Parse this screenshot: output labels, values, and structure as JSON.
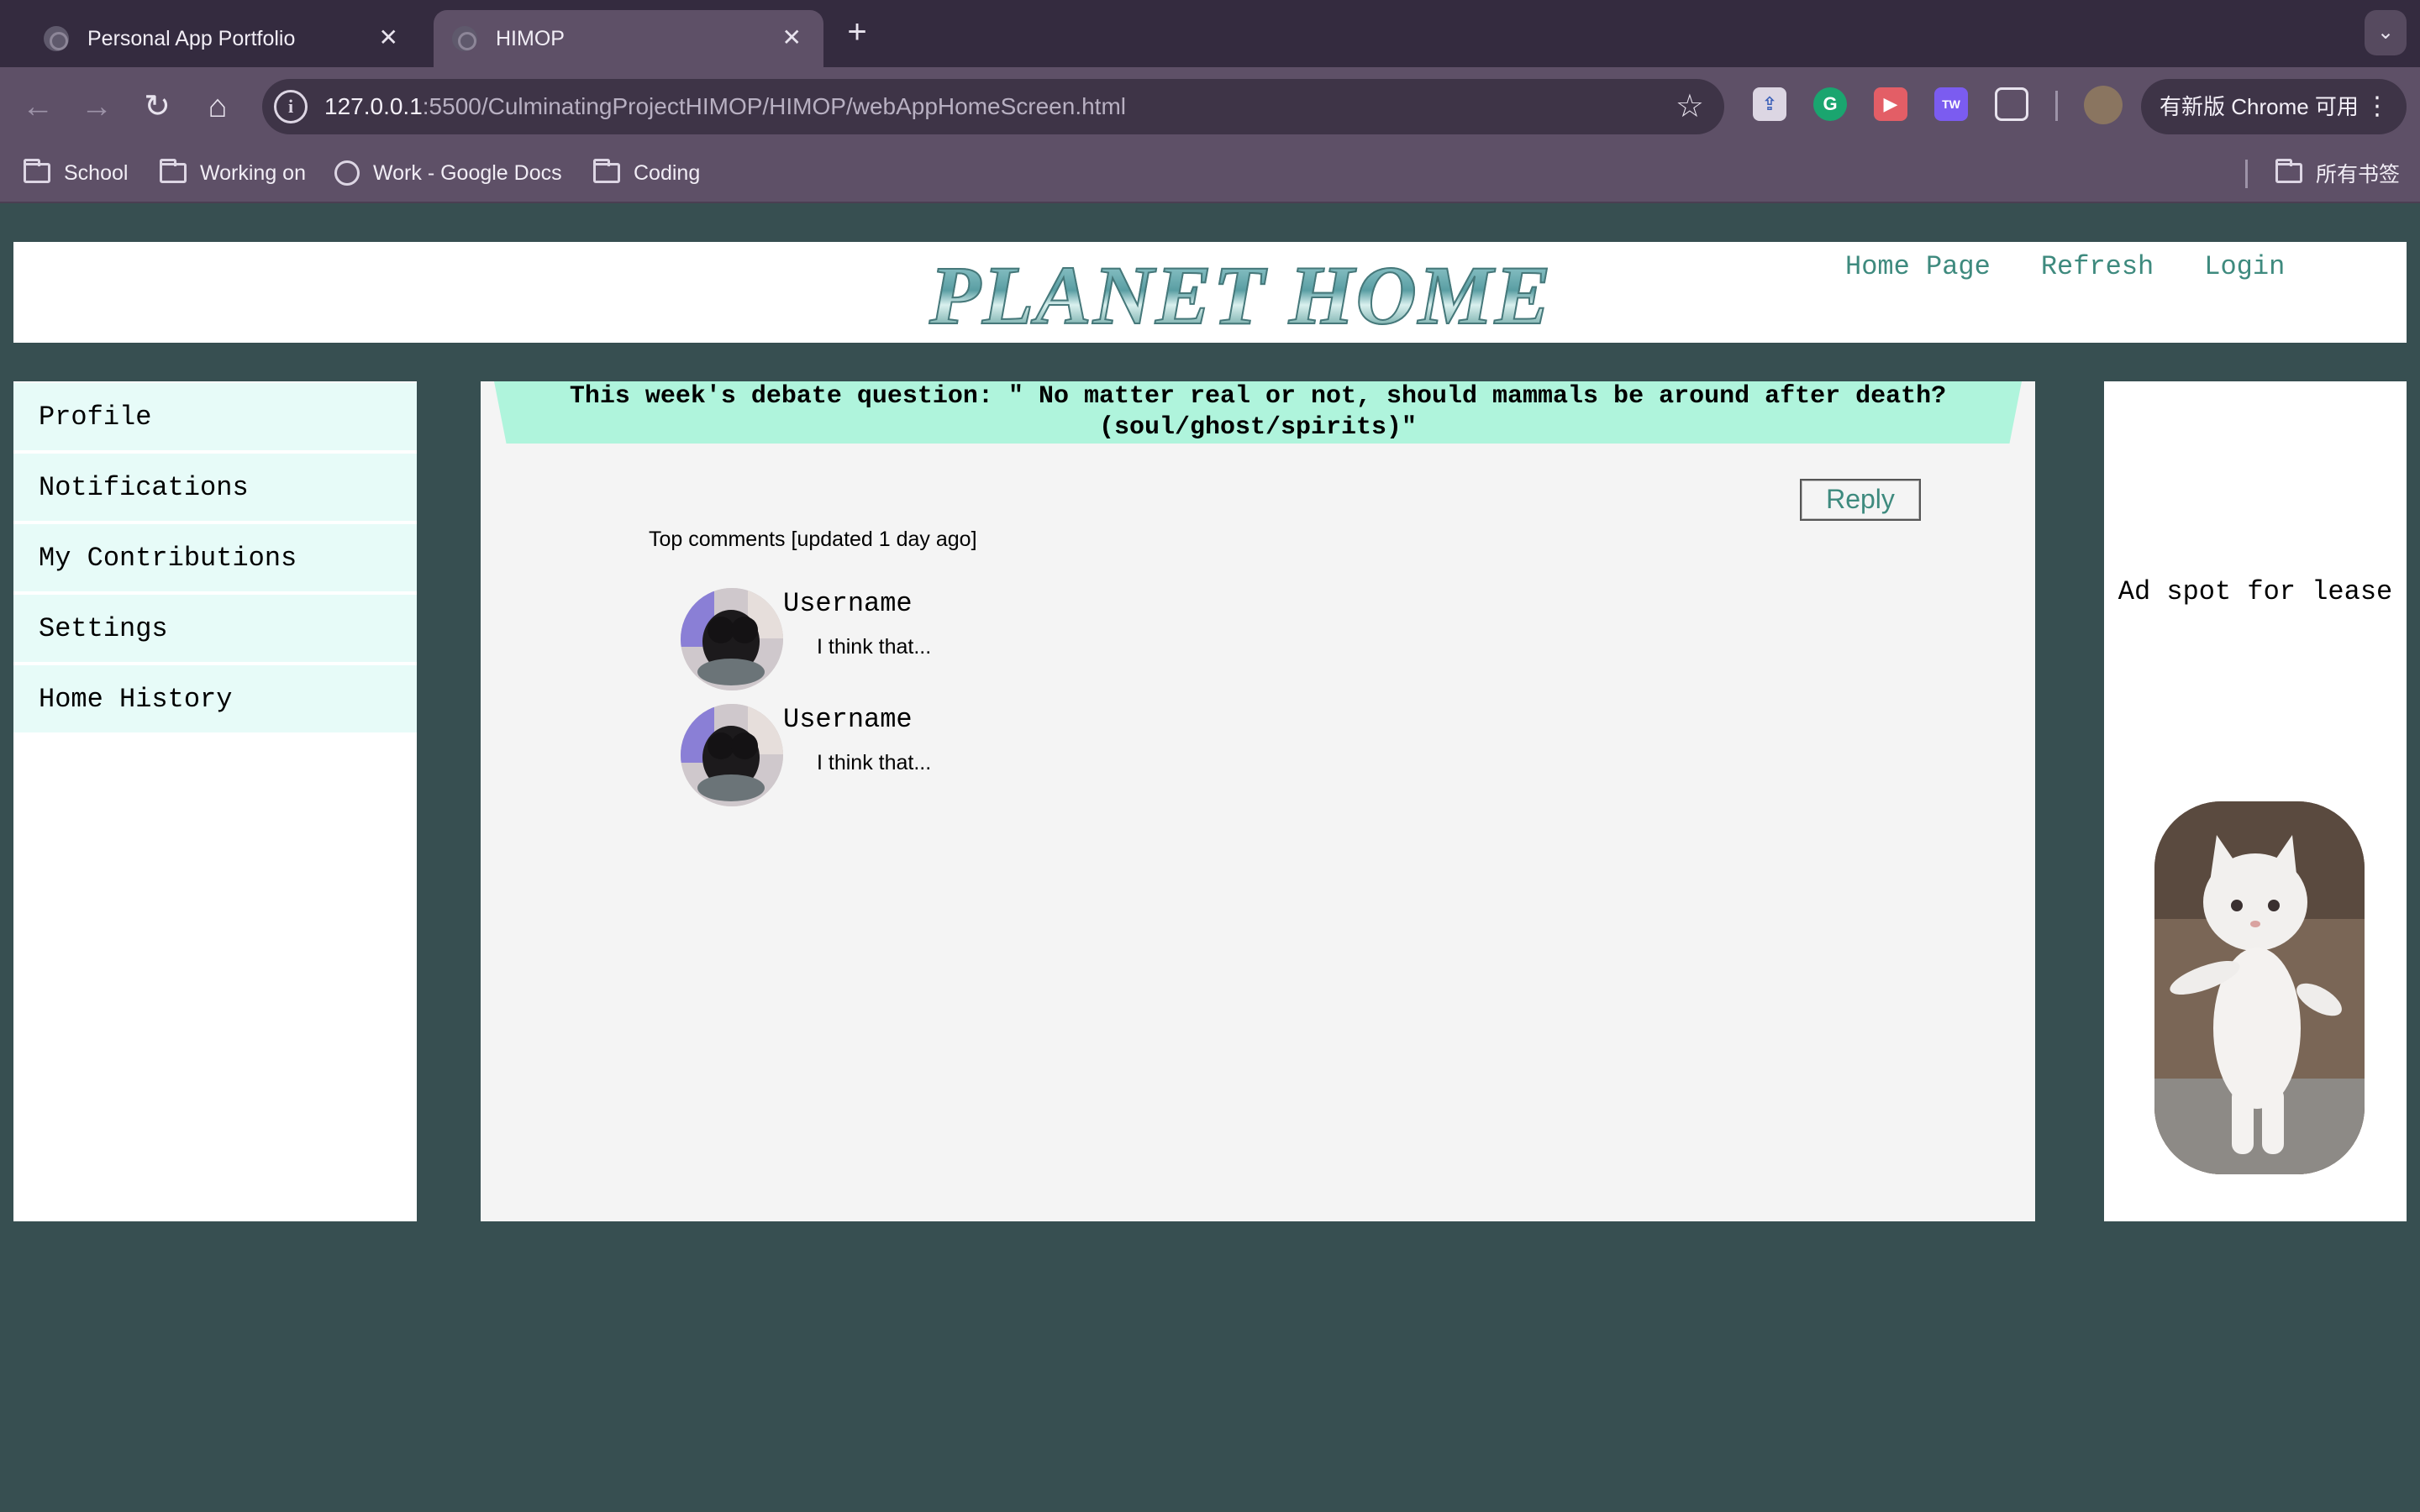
{
  "browser": {
    "tabs": [
      {
        "title": "Personal App Portfolio",
        "active": false
      },
      {
        "title": "HIMOP",
        "active": true
      }
    ],
    "close_glyph": "✕",
    "new_tab_glyph": "+",
    "tab_search_glyph": "⌄",
    "nav": {
      "back_glyph": "←",
      "forward_glyph": "→",
      "reload_glyph": "↻",
      "home_glyph": "⌂"
    },
    "omnibox": {
      "info_glyph": "i",
      "url_host": "127.0.0.1",
      "url_rest": ":5500/CulminatingProjectHIMOP/HIMOP/webAppHomeScreen.html",
      "star_glyph": "☆"
    },
    "extensions": [
      "extension-1-icon",
      "grammarly-icon",
      "video-extension-icon",
      "tw-extension-icon",
      "extensions-puzzle-icon"
    ],
    "update_label": "有新版 Chrome 可用",
    "menu_glyph": "⋮",
    "bookmarks": [
      {
        "label": "School",
        "icon": "folder-icon"
      },
      {
        "label": "Working on",
        "icon": "folder-icon"
      },
      {
        "label": "Work - Google Docs",
        "icon": "globe-icon"
      },
      {
        "label": "Coding",
        "icon": "folder-icon"
      }
    ],
    "all_bookmarks_label": "所有书签"
  },
  "header": {
    "logo_text": "PLANET HOME",
    "nav": [
      "Home Page",
      "Refresh",
      "Login"
    ]
  },
  "sidebar": {
    "items": [
      "Profile",
      "Notifications",
      "My Contributions",
      "Settings",
      "Home History"
    ]
  },
  "main": {
    "question_line1": "This week's debate question: \" No matter real or not, should mammals be around after death?",
    "question_line2": "(soul/ghost/spirits)\"",
    "reply_label": "Reply",
    "comments_heading": "Top comments [updated 1 day ago]",
    "comments": [
      {
        "username": "Username",
        "text": "I think that..."
      },
      {
        "username": "Username",
        "text": "I think that..."
      }
    ]
  },
  "ad": {
    "text": "Ad spot for lease"
  },
  "colors": {
    "page_bg": "#374f51",
    "accent_link": "#3e8a7e",
    "sidebar_item_bg": "#e7fbf8",
    "question_bg": "#aff4dc",
    "main_bg": "#f4f4f4"
  }
}
